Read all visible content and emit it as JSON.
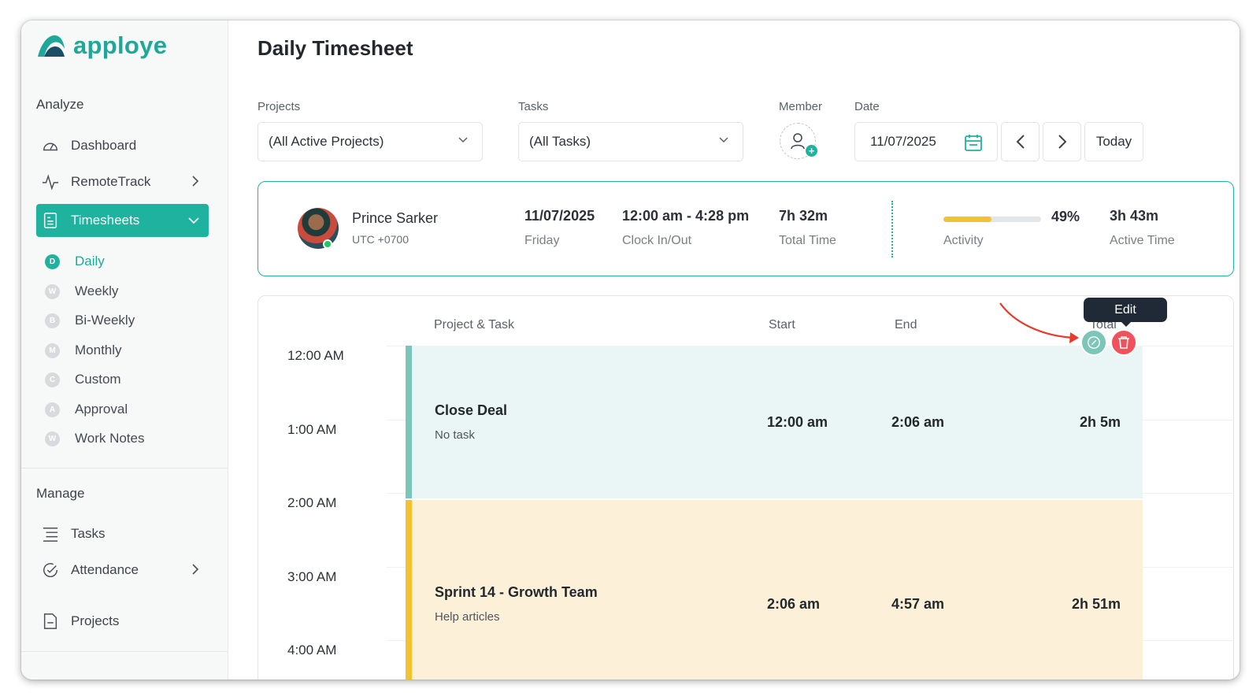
{
  "app": {
    "logo_text": "apploye"
  },
  "sidebar": {
    "analyze_title": "Analyze",
    "manage_title": "Manage",
    "nav": {
      "dashboard": "Dashboard",
      "remotetrack": "RemoteTrack",
      "timesheets": "Timesheets",
      "tasks": "Tasks",
      "attendance": "Attendance",
      "projects": "Projects"
    },
    "sub_items": [
      {
        "badge": "D",
        "label": "Daily"
      },
      {
        "badge": "W",
        "label": "Weekly"
      },
      {
        "badge": "B",
        "label": "Bi-Weekly"
      },
      {
        "badge": "M",
        "label": "Monthly"
      },
      {
        "badge": "C",
        "label": "Custom"
      },
      {
        "badge": "A",
        "label": "Approval"
      },
      {
        "badge": "W",
        "label": "Work Notes"
      }
    ]
  },
  "main": {
    "title": "Daily Timesheet",
    "filters": {
      "projects_label": "Projects",
      "projects_value": "(All Active Projects)",
      "tasks_label": "Tasks",
      "tasks_value": "(All Tasks)",
      "member_label": "Member",
      "date_label": "Date",
      "date_value": "11/07/2025",
      "today_label": "Today"
    },
    "summary": {
      "name": "Prince Sarker",
      "timezone": "UTC +0700",
      "date": "11/07/2025",
      "weekday": "Friday",
      "clock": "12:00 am - 4:28 pm",
      "clock_label": "Clock In/Out",
      "total": "7h 32m",
      "total_label": "Total Time",
      "activity_percent": "49%",
      "activity_value": 49,
      "activity_label": "Activity",
      "active_time": "3h 43m",
      "active_time_label": "Active Time"
    },
    "table": {
      "headers": {
        "project_task": "Project & Task",
        "start": "Start",
        "end": "End",
        "total": "Total"
      },
      "hours": [
        "12:00 AM",
        "1:00 AM",
        "2:00 AM",
        "3:00 AM",
        "4:00 AM"
      ],
      "entries": [
        {
          "project": "Close Deal",
          "task": "No task",
          "start": "12:00 am",
          "end": "2:06 am",
          "total": "2h 5m"
        },
        {
          "project": "Sprint 14 - Growth Team",
          "task": "Help articles",
          "start": "2:06 am",
          "end": "4:57 am",
          "total": "2h 51m"
        }
      ],
      "tooltip": "Edit"
    }
  },
  "colors": {
    "brand": "#1fb39f",
    "entry1_bg": "#e9f6f5",
    "entry1_bar": "#7cc5b9",
    "entry2_bg": "#fcf1d8",
    "entry2_bar": "#f4c22e",
    "delete": "#f0525c",
    "annotation_arrow": "#e8392b"
  }
}
